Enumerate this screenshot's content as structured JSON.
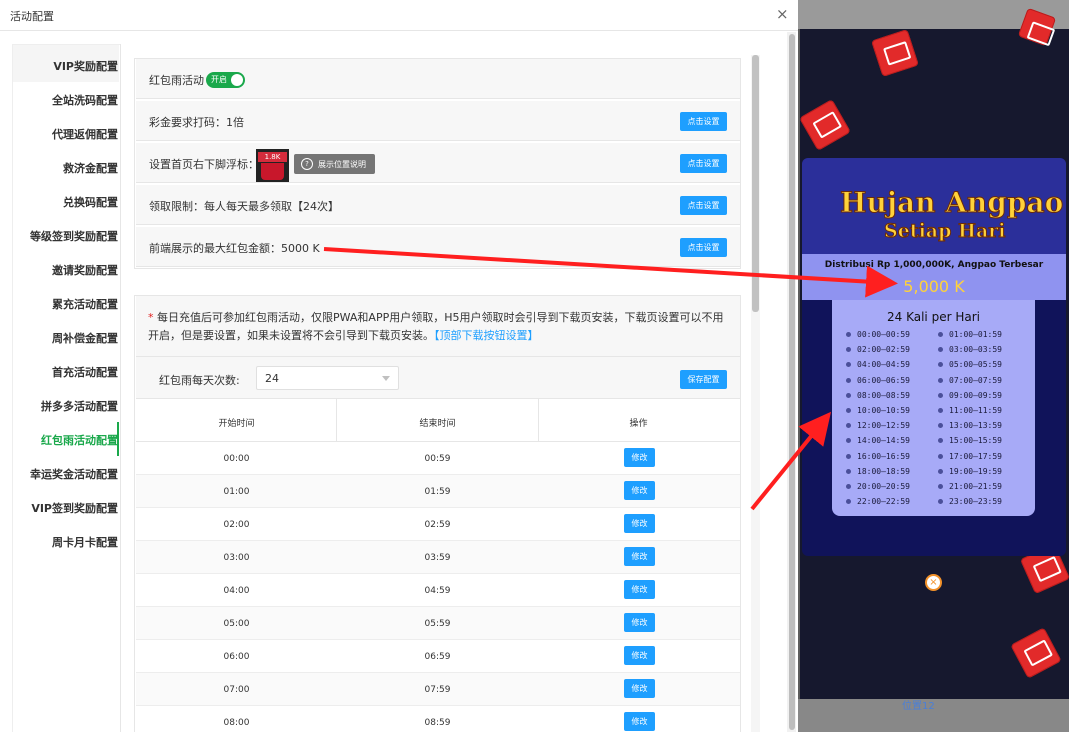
{
  "dialog": {
    "title": "活动配置",
    "close_glyph": "×"
  },
  "sidebar": {
    "items": [
      "VIP奖励配置",
      "全站洗码配置",
      "代理返佣配置",
      "救济金配置",
      "兑换码配置",
      "等级签到奖励配置",
      "邀请奖励配置",
      "累充活动配置",
      "周补偿金配置",
      "首充活动配置",
      "拼多多活动配置",
      "红包雨活动配置",
      "幸运奖金活动配置",
      "VIP签到奖励配置",
      "周卡月卡配置"
    ],
    "active_index": 11,
    "accent_color": "#1aa84b"
  },
  "settings": {
    "rain_label": "红包雨活动",
    "rain_switch": "开启",
    "bet_label": "彩金要求打码：1倍",
    "float_label": "设置首页右下脚浮标：",
    "float_thumb_text": "1.8K",
    "float_help_btn": "展示位置说明",
    "limit_label": "领取限制：每人每天最多领取【24次】",
    "max_label": "前端展示的最大红包金额：5000 K",
    "set_btn": "点击设置"
  },
  "notice": {
    "star": "*",
    "text": "每日充值后可参加红包雨活动，仅限PWA和APP用户领取，H5用户领取时会引导到下载页安装，下载页设置可以不用开启，但是要设置，如果未设置将不会引导到下载页安装。",
    "link": "【顶部下载按钮设置】"
  },
  "count": {
    "label": "红包雨每天次数:",
    "value": "24",
    "save_btn": "保存配置"
  },
  "table": {
    "headers": [
      "开始时间",
      "结束时间",
      "操作"
    ],
    "edit_label": "修改",
    "rows": [
      [
        "00:00",
        "00:59"
      ],
      [
        "01:00",
        "01:59"
      ],
      [
        "02:00",
        "02:59"
      ],
      [
        "03:00",
        "03:59"
      ],
      [
        "04:00",
        "04:59"
      ],
      [
        "05:00",
        "05:59"
      ],
      [
        "06:00",
        "06:59"
      ],
      [
        "07:00",
        "07:59"
      ],
      [
        "08:00",
        "08:59"
      ]
    ]
  },
  "promo": {
    "title1": "Hujan Angpao",
    "title2": "Setiap Hari",
    "distribution": "Distribusi Rp 1,000,000K, Angpao Terbesar",
    "max_amount": "5,000 K",
    "per_day": "24 Kali per Hari",
    "slots": [
      "00:00—00:59",
      "01:00—01:59",
      "02:00—02:59",
      "03:00—03:59",
      "04:00—04:59",
      "05:00—05:59",
      "06:00—06:59",
      "07:00—07:59",
      "08:00—08:59",
      "09:00—09:59",
      "10:00—10:59",
      "11:00—11:59",
      "12:00—12:59",
      "13:00—13:59",
      "14:00—14:59",
      "15:00—15:59",
      "16:00—16:59",
      "17:00—17:59",
      "18:00—18:59",
      "19:00—19:59",
      "20:00—20:59",
      "21:00—21:59",
      "22:00—22:59",
      "23:00—23:59"
    ],
    "position_label": "位置12",
    "close_glyph": "×"
  },
  "colors": {
    "primary_button": "#1e9fff",
    "switch_on": "#1aa84b",
    "annotation_arrow": "#ff1f1f",
    "promo_gold": "#ffd23a"
  }
}
